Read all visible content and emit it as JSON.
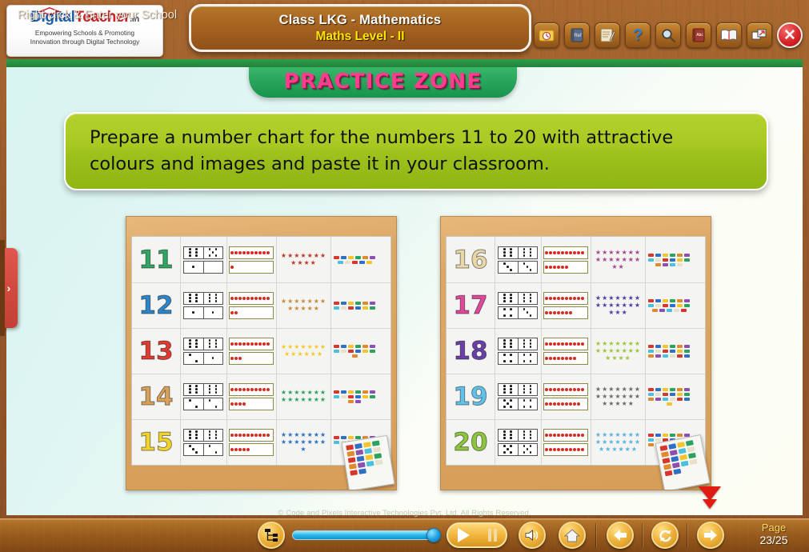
{
  "window": {
    "app_background_color": "#9a5c1f"
  },
  "logo": {
    "name_part1": "Digital",
    "name_part2": "Teacher",
    "tld": ".in",
    "tagline_line1": "Empowering Schools & Promoting",
    "tagline_line2": "Innovation through Digital Technology",
    "cap_icon": "graduation-cap-icon"
  },
  "header": {
    "title_line1": "Class LKG - Mathematics",
    "title_line2": "Maths Level - II",
    "title_color_line1": "#ffffff",
    "title_color_line2": "#ffe400",
    "toolbar": [
      {
        "name": "timer-icon",
        "glyph": "⏱",
        "label": "Timer"
      },
      {
        "name": "reference-book-icon",
        "glyph": "📘",
        "label": "Reference"
      },
      {
        "name": "notepad-pen-icon",
        "glyph": "📝",
        "label": "Notes"
      },
      {
        "name": "help-question-icon",
        "glyph": "?",
        "label": "Help"
      },
      {
        "name": "search-magnifier-icon",
        "glyph": "🔍",
        "label": "Search"
      },
      {
        "name": "abc-dictionary-icon",
        "glyph": "📕",
        "label": "Dictionary"
      },
      {
        "name": "open-book-icon",
        "glyph": "📖",
        "label": "Glossary"
      },
      {
        "name": "fullscreen-resize-icon",
        "glyph": "❐",
        "label": "Resize"
      }
    ],
    "close_label": "✕"
  },
  "stage": {
    "banner_text": "PRACTICE ZONE",
    "banner_text_color": "#ff3c8e",
    "banner_bg_color": "#27a35a",
    "instruction_text": "Prepare a number chart for the numbers 11 to 20 with attractive colours and images and paste it in your classroom.",
    "instruction_bg_color": "#a8c922"
  },
  "photos": [
    {
      "name": "number-chart-photo-11-to-20-part1",
      "caption": "Number chart photo showing 11 to 15",
      "rows": [
        {
          "number": "11",
          "color": "#2fa663",
          "dominoes": [
            [
              6,
              5
            ],
            [
              1,
              0
            ]
          ],
          "apples": [
            10,
            1
          ],
          "stars": 11,
          "star_color": "#c0392b",
          "sticks": 11
        },
        {
          "number": "12",
          "color": "#2e86c8",
          "dominoes": [
            [
              6,
              6
            ],
            [
              1,
              1
            ]
          ],
          "apples": [
            10,
            2
          ],
          "stars": 12,
          "star_color": "#c98b3a",
          "sticks": 12
        },
        {
          "number": "13",
          "color": "#e03a2f",
          "dominoes": [
            [
              6,
              6
            ],
            [
              2,
              1
            ]
          ],
          "apples": [
            10,
            3
          ],
          "stars": 13,
          "star_color": "#f2c928",
          "sticks": 13
        },
        {
          "number": "14",
          "color": "#d9a057",
          "dominoes": [
            [
              6,
              6
            ],
            [
              2,
              2
            ]
          ],
          "apples": [
            10,
            4
          ],
          "stars": 14,
          "star_color": "#2aa35f",
          "sticks": 14
        },
        {
          "number": "15",
          "color": "#f2d32e",
          "dominoes": [
            [
              6,
              6
            ],
            [
              3,
              2
            ]
          ],
          "apples": [
            10,
            5
          ],
          "stars": 15,
          "star_color": "#2f6fc4",
          "sticks": 15
        }
      ]
    },
    {
      "name": "number-chart-photo-11-to-20-part2",
      "caption": "Number chart photo showing 16 to 20",
      "rows": [
        {
          "number": "16",
          "color": "#e8d7a8",
          "dominoes": [
            [
              6,
              6
            ],
            [
              3,
              3
            ]
          ],
          "apples": [
            10,
            6
          ],
          "stars": 16,
          "star_color": "#a4478c",
          "sticks": 16
        },
        {
          "number": "17",
          "color": "#e0489a",
          "dominoes": [
            [
              6,
              6
            ],
            [
              4,
              3
            ]
          ],
          "apples": [
            10,
            7
          ],
          "stars": 17,
          "star_color": "#4b3fa8",
          "sticks": 17
        },
        {
          "number": "18",
          "color": "#6a3fa8",
          "dominoes": [
            [
              6,
              6
            ],
            [
              4,
              4
            ]
          ],
          "apples": [
            10,
            8
          ],
          "stars": 18,
          "star_color": "#9cc63a",
          "sticks": 18
        },
        {
          "number": "19",
          "color": "#5fc2e8",
          "dominoes": [
            [
              6,
              6
            ],
            [
              5,
              4
            ]
          ],
          "apples": [
            10,
            9
          ],
          "stars": 19,
          "star_color": "#6b6b6b",
          "sticks": 19
        },
        {
          "number": "20",
          "color": "#8cc63e",
          "dominoes": [
            [
              6,
              6
            ],
            [
              5,
              5
            ]
          ],
          "apples": [
            10,
            10
          ],
          "stars": 20,
          "star_color": "#56b4d8",
          "sticks": 20
        }
      ]
    }
  ],
  "side_tab": {
    "name": "expand-side-panel-tab",
    "glyph": "›",
    "color": "#d24a3e"
  },
  "pointer_marks": {
    "name": "red-pointer-triangles",
    "color": "#e01b14",
    "count": 2
  },
  "copyright": "© Code and Pixels Interactive Technologies  Pvt. Ltd. All Rights Reserved.",
  "bottombar": {
    "school_text": "Right click & Enter your School",
    "tree_icon": "index-tree-icon",
    "slider": {
      "name": "progress-slider",
      "value_percent": 100
    },
    "play_label": "play-icon",
    "pause_label": "pause-icon",
    "volume_label": "volume-icon",
    "home_label": "home-icon",
    "back_label": "previous-arrow-icon",
    "refresh_label": "refresh-icon",
    "next_label": "next-arrow-icon",
    "page_label": "Page",
    "page_value": "23/25",
    "page_label_color": "#ffd85e"
  }
}
